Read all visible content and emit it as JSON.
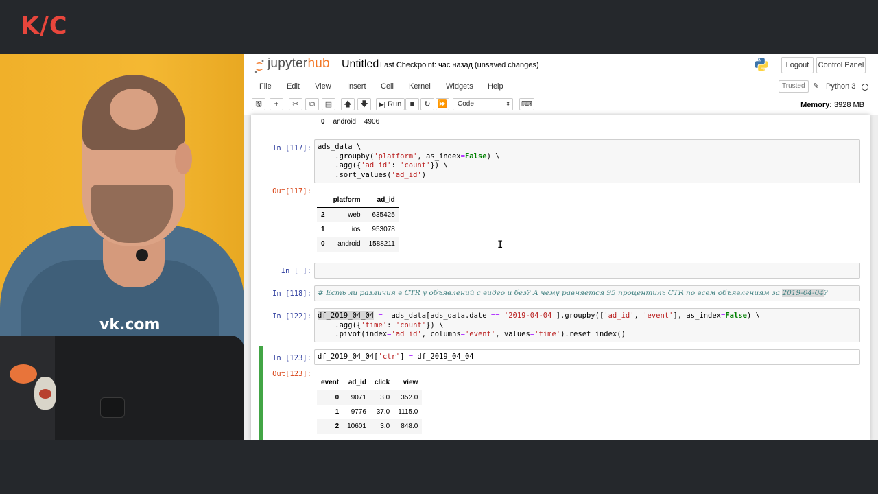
{
  "brand": {
    "logo": "K/C"
  },
  "webcam": {
    "hoodie_text": "vk.com"
  },
  "header": {
    "logo_text_1": "jupyter",
    "logo_text_2": "hub",
    "title": "Untitled",
    "checkpoint": "Last Checkpoint: час назад",
    "unsaved": "(unsaved changes)",
    "logout": "Logout",
    "control_panel": "Control Panel"
  },
  "menu": {
    "items": [
      "File",
      "Edit",
      "View",
      "Insert",
      "Cell",
      "Kernel",
      "Widgets",
      "Help"
    ],
    "trusted": "Trusted",
    "kernel": "Python 3"
  },
  "toolbar": {
    "run_label": "Run",
    "cell_type": "Code",
    "memory_label": "Memory:",
    "memory_value": "3928 MB"
  },
  "cells": {
    "prev_row": {
      "index": "0",
      "platform": "android",
      "value": "4906"
    },
    "c117": {
      "in_prompt": "In [117]:",
      "out_prompt": "Out[117]:",
      "table": {
        "columns": [
          "platform",
          "ad_id"
        ],
        "rows": [
          {
            "idx": "2",
            "platform": "web",
            "ad_id": "635425"
          },
          {
            "idx": "1",
            "platform": "ios",
            "ad_id": "953078"
          },
          {
            "idx": "0",
            "platform": "android",
            "ad_id": "1588211"
          }
        ]
      }
    },
    "empty": {
      "in_prompt": "In [ ]:"
    },
    "c118": {
      "in_prompt": "In [118]:",
      "comment": "# Есть ли различия в CTR у объявлений с видео и без? А чему равняется 95 процентиль CTR по всем объявлениям за ",
      "comment_date": "2019-04-04",
      "comment_end": "?"
    },
    "c122": {
      "in_prompt": "In [122]:"
    },
    "c123": {
      "in_prompt": "In [123]:",
      "out_prompt": "Out[123]:",
      "table": {
        "columns": [
          "event",
          "ad_id",
          "click",
          "view"
        ],
        "rows": [
          {
            "idx": "0",
            "ad_id": "9071",
            "click": "3.0",
            "view": "352.0"
          },
          {
            "idx": "1",
            "ad_id": "9776",
            "click": "37.0",
            "view": "1115.0"
          },
          {
            "idx": "2",
            "ad_id": "10601",
            "click": "3.0",
            "view": "848.0"
          }
        ]
      }
    }
  }
}
